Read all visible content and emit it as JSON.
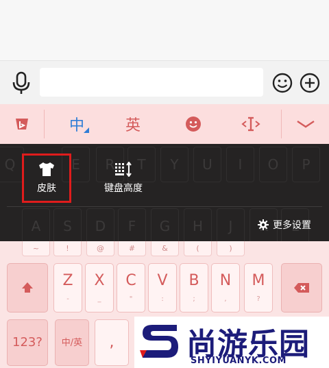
{
  "toolbar": {
    "chinese_label": "中",
    "english_label": "英"
  },
  "menu": {
    "skin_label": "皮肤",
    "keyboard_height_label": "键盘高度",
    "more_settings_label": "更多设置"
  },
  "ghost_keys_row1": [
    "Q",
    "E",
    "R",
    "T",
    "Y",
    "U",
    "I",
    "O",
    "P"
  ],
  "ghost_keys_row2": [
    "A",
    "S",
    "D",
    "F",
    "G",
    "H",
    "J",
    "K",
    "L"
  ],
  "symbols": [
    "~",
    "!",
    "@",
    "#",
    "&",
    "(",
    ")"
  ],
  "keys_row3": [
    {
      "main": "Z",
      "sub": "-"
    },
    {
      "main": "X",
      "sub": "_"
    },
    {
      "main": "C",
      "sub": "\""
    },
    {
      "main": "V",
      "sub": ":"
    },
    {
      "main": "B",
      "sub": ";"
    },
    {
      "main": "N",
      "sub": ","
    },
    {
      "main": "M",
      "sub": "?"
    }
  ],
  "keys_row4": {
    "numbers_label": "123?",
    "lang_label": "中/英",
    "comma_label": ","
  },
  "watermark": {
    "brand_text": "尚游乐园",
    "domain_text": "SHYIYUANYK.COM"
  },
  "colors": {
    "accent": "#d45b5b",
    "highlight_border": "#e01c1c",
    "chinese_active": "#2f7dd6"
  }
}
